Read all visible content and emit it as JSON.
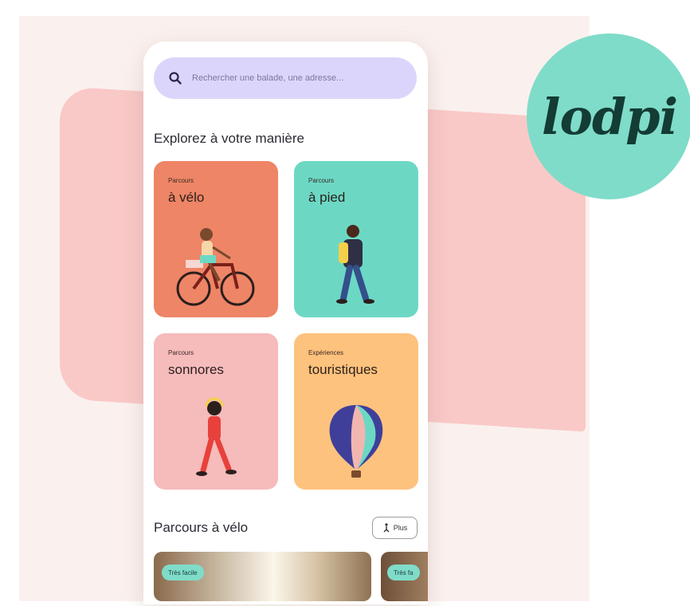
{
  "brand": {
    "logo_text": "lodpi",
    "logo_color": "#7fdcc9"
  },
  "search": {
    "placeholder": "Rechercher une balade, une adresse..."
  },
  "explore": {
    "title": "Explorez à votre manière",
    "cards": [
      {
        "kicker": "Parcours",
        "title": "à vélo",
        "color": "#ee8566",
        "icon": "cyclist-illustration"
      },
      {
        "kicker": "Parcours",
        "title": "à pied",
        "color": "#6cd8c4",
        "icon": "walker-illustration"
      },
      {
        "kicker": "Parcours",
        "title": "sonnores",
        "color": "#f6bbbb",
        "icon": "headphones-walker-illustration"
      },
      {
        "kicker": "Expériences",
        "title": "touristiques",
        "color": "#fdc27d",
        "icon": "hot-air-balloon-illustration"
      }
    ]
  },
  "routes": {
    "title": "Parcours à vélo",
    "plus_label": "Plus",
    "items": [
      {
        "badge": "Très facile"
      },
      {
        "badge": "Très fa"
      }
    ]
  }
}
